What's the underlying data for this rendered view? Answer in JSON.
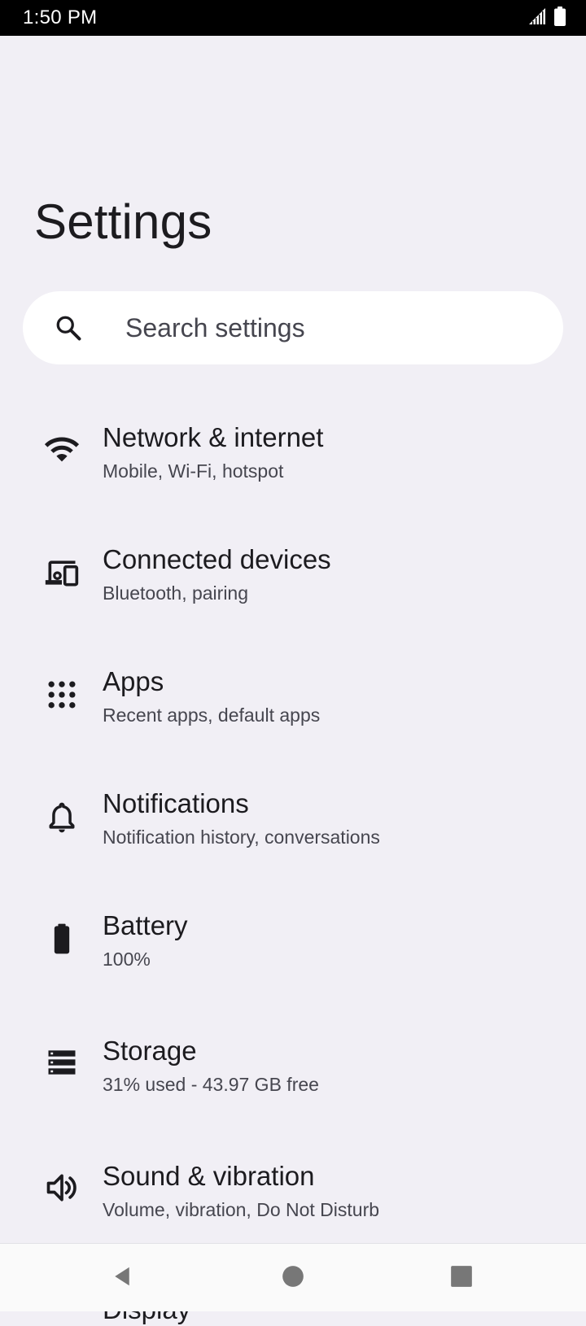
{
  "status_bar": {
    "time": "1:50 PM",
    "icons": [
      "signal-icon",
      "battery-icon"
    ]
  },
  "page": {
    "title": "Settings"
  },
  "search": {
    "placeholder": "Search settings",
    "value": ""
  },
  "settings_items": [
    {
      "icon": "wifi-icon",
      "title": "Network & internet",
      "summary": "Mobile, Wi-Fi, hotspot"
    },
    {
      "icon": "devices-icon",
      "title": "Connected devices",
      "summary": "Bluetooth, pairing"
    },
    {
      "icon": "apps-grid-icon",
      "title": "Apps",
      "summary": "Recent apps, default apps"
    },
    {
      "icon": "bell-icon",
      "title": "Notifications",
      "summary": "Notification history, conversations"
    },
    {
      "icon": "battery-icon",
      "title": "Battery",
      "summary": "100%"
    },
    {
      "icon": "storage-icon",
      "title": "Storage",
      "summary": "31% used - 43.97 GB free"
    },
    {
      "icon": "speaker-icon",
      "title": "Sound & vibration",
      "summary": "Volume, vibration, Do Not Disturb"
    }
  ],
  "partially_visible_item": {
    "title": "Display"
  },
  "nav_bar": {
    "buttons": [
      "back-icon",
      "home-icon",
      "recents-icon"
    ]
  },
  "colors": {
    "background": "#f1eff5",
    "search_bg": "#ffffff",
    "text_primary": "#1c1b1f",
    "text_secondary": "#46464f",
    "status_bar_bg": "#000000"
  }
}
